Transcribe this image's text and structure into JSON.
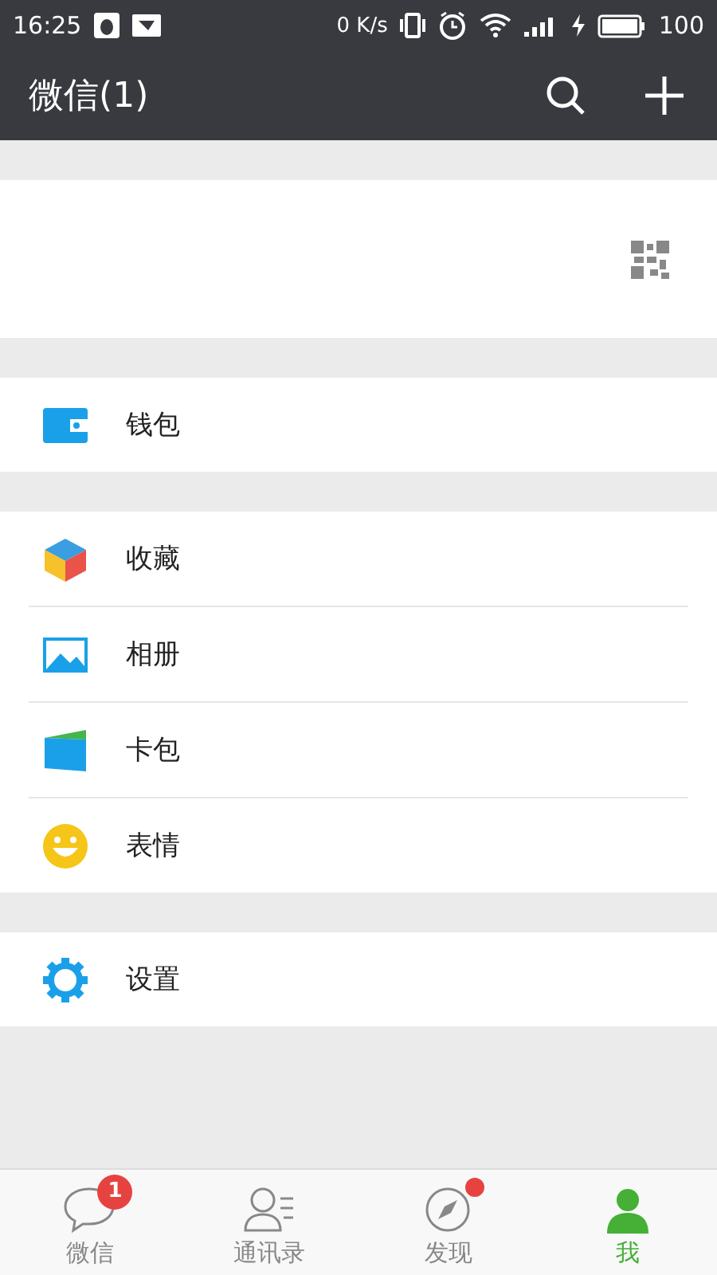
{
  "status_bar": {
    "time": "16:25",
    "speed": "0 K/s",
    "battery": "100"
  },
  "app_bar": {
    "title": "微信(1)"
  },
  "groups": [
    {
      "items": [
        {
          "kind": "wallet",
          "label": "钱包"
        }
      ]
    },
    {
      "items": [
        {
          "kind": "favorites",
          "label": "收藏"
        },
        {
          "kind": "album",
          "label": "相册"
        },
        {
          "kind": "cards",
          "label": "卡包"
        },
        {
          "kind": "stickers",
          "label": "表情"
        }
      ]
    },
    {
      "items": [
        {
          "kind": "settings",
          "label": "设置"
        }
      ]
    }
  ],
  "tabs": [
    {
      "kind": "chats",
      "label": "微信",
      "selected": false,
      "badge": "1",
      "dot": false
    },
    {
      "kind": "contacts",
      "label": "通讯录",
      "selected": false,
      "dot": false
    },
    {
      "kind": "discover",
      "label": "发现",
      "selected": false,
      "dot": true
    },
    {
      "kind": "me",
      "label": "我",
      "selected": true,
      "dot": false
    }
  ]
}
